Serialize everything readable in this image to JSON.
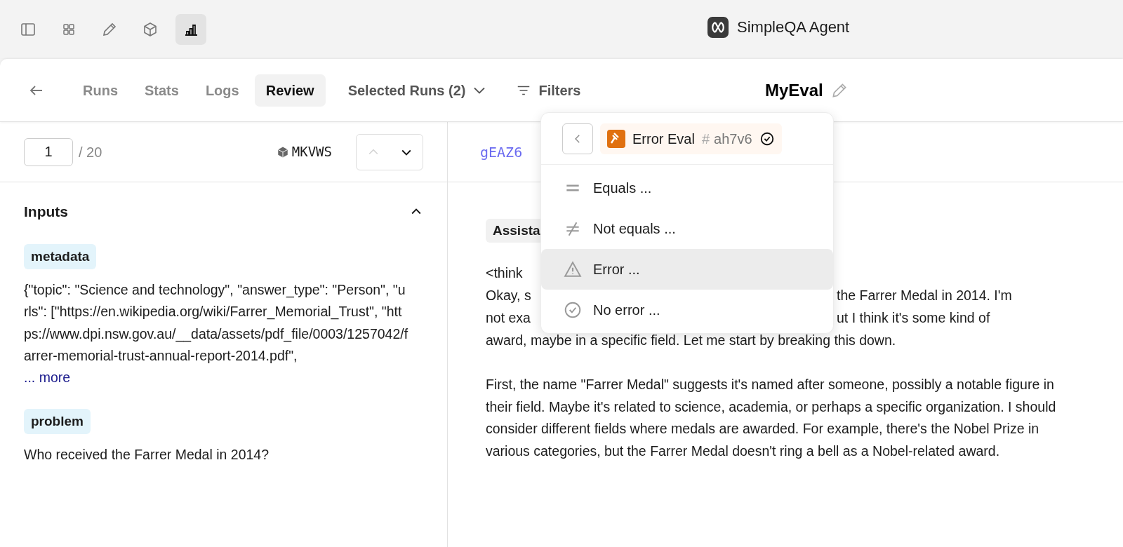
{
  "toolbar_buttons": [
    {
      "kind": "sidebar",
      "selected": false
    },
    {
      "kind": "grid",
      "selected": false
    },
    {
      "kind": "pencil",
      "selected": false
    },
    {
      "kind": "cube",
      "selected": false
    },
    {
      "kind": "chart",
      "selected": true
    }
  ],
  "window": {
    "title": "SimpleQA Agent"
  },
  "nav": {
    "tabs": [
      {
        "label": "Runs",
        "selected": false
      },
      {
        "label": "Stats",
        "selected": false
      },
      {
        "label": "Logs",
        "selected": false
      },
      {
        "label": "Review",
        "selected": true
      }
    ],
    "selected_runs": "Selected Runs (2)",
    "filters": "Filters",
    "eval_name": "MyEval"
  },
  "pager": {
    "value": "1",
    "total": "/ 20",
    "sample_id": "MKVWS",
    "prev_disabled": true
  },
  "inputs": {
    "title": "Inputs",
    "expanded": true,
    "fields": [
      {
        "key": "metadata",
        "value": "{\"topic\": \"Science and technology\", \"answer_type\": \"Person\", \"urls\": [\"https://en.wikipedia.org/wiki/Farrer_Memorial_Trust\", \"https://www.dpi.nsw.gov.au/__data/assets/pdf_file/0003/1257042/farrer-memorial-trust-annual-report-2014.pdf\",",
        "more": "... more"
      },
      {
        "key": "problem",
        "value": "Who received the Farrer Medal in 2014?"
      }
    ]
  },
  "output": {
    "id": "gEAZ6",
    "role_badge": "Assista",
    "lines": [
      {
        "left": "<think"
      },
      {
        "left": "Okay, s",
        "right": "the Farrer Medal in 2014. I'm"
      },
      {
        "left": "not exa",
        "right": "ut I think it's some kind of"
      }
    ],
    "paragraphs": [
      "award, maybe in a specific field. Let me start by breaking this down.",
      "First, the name \"Farrer Medal\" suggests it's named after someone, possibly a notable figure in their field. Maybe it's related to science, academia, or perhaps a specific organization. I should consider different fields where medals are awarded. For example, there's the Nobel Prize in various categories, but the Farrer Medal doesn't ring a bell as a Nobel-related award."
    ]
  },
  "filter_menu": {
    "eval": {
      "name": "Error Eval",
      "hash": "#",
      "id": "ah7v6"
    },
    "options": [
      {
        "kind": "equals",
        "label": "Equals ...",
        "selected": false
      },
      {
        "kind": "not_equals",
        "label": "Not equals ...",
        "selected": false
      },
      {
        "kind": "error",
        "label": "Error ...",
        "selected": true
      },
      {
        "kind": "no_error",
        "label": "No error ...",
        "selected": false
      }
    ]
  }
}
